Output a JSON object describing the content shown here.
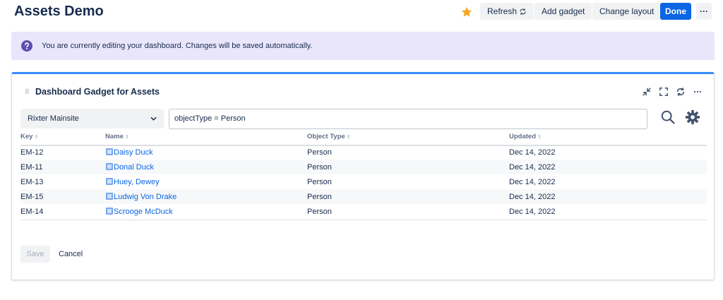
{
  "header": {
    "title": "Assets Demo",
    "refresh_label": "Refresh",
    "add_gadget_label": "Add gadget",
    "change_layout_label": "Change layout",
    "done_label": "Done",
    "more_label": "···"
  },
  "banner": {
    "message": "You are currently editing your dashboard. Changes will be saved automatically."
  },
  "gadget": {
    "title": "Dashboard Gadget for Assets",
    "schema_select": "Rixter Mainsite",
    "query": "objectType = Person",
    "columns": [
      "Key",
      "Name",
      "Object Type",
      "Updated"
    ],
    "rows": [
      {
        "key": "EM-12",
        "name": "Daisy Duck",
        "type": "Person",
        "updated": "Dec 14, 2022"
      },
      {
        "key": "EM-11",
        "name": "Donal Duck",
        "type": "Person",
        "updated": "Dec 14, 2022"
      },
      {
        "key": "EM-13",
        "name": "Huey, Dewey",
        "type": "Person",
        "updated": "Dec 14, 2022"
      },
      {
        "key": "EM-15",
        "name": "Ludwig Von Drake",
        "type": "Person",
        "updated": "Dec 14, 2022"
      },
      {
        "key": "EM-14",
        "name": "Scrooge McDuck",
        "type": "Person",
        "updated": "Dec 14, 2022"
      }
    ],
    "save_label": "Save",
    "cancel_label": "Cancel"
  },
  "icons": {
    "star": "star-icon",
    "refresh": "refresh-icon",
    "question": "question-icon",
    "minimize": "minimize-icon",
    "fullscreen": "fullscreen-icon",
    "reload": "reload-icon",
    "search": "search-icon",
    "gear": "gear-icon",
    "object": "object-type-icon"
  },
  "colors": {
    "primary": "#0c66e4",
    "banner_bg": "#e9e6fb",
    "star": "#f5a623",
    "gadget_accent": "#388bff",
    "question_icon": "#5e4db2"
  }
}
